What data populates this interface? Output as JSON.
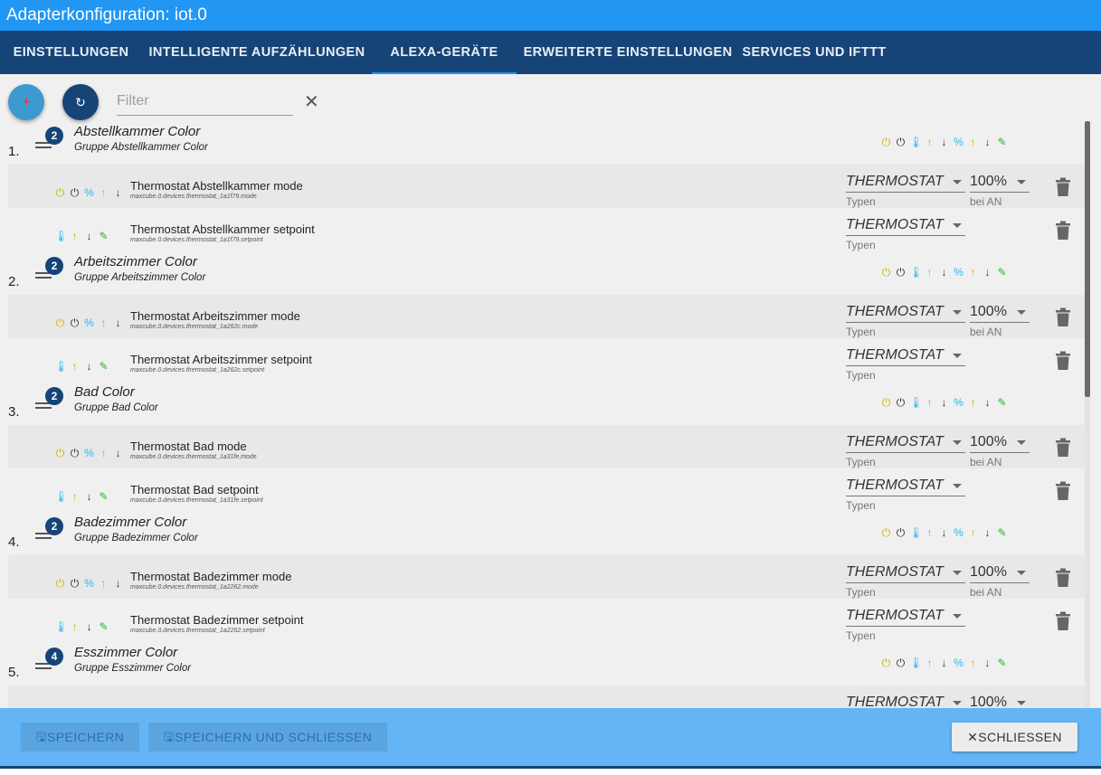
{
  "window": {
    "title": "Adapterkonfiguration: iot.0"
  },
  "tabs": [
    {
      "label": "EINSTELLUNGEN"
    },
    {
      "label": "INTELLIGENTE AUFZÄHLUNGEN"
    },
    {
      "label": "ALEXA-GERÄTE"
    },
    {
      "label": "ERWEITERTE EINSTELLUNGEN"
    },
    {
      "label": "SERVICES UND IFTTT"
    }
  ],
  "active_tab": "ALEXA-GERÄTE",
  "toolbar": {
    "add_icon": "plus-icon",
    "refresh_icon": "refresh-icon",
    "filter_placeholder": "Filter",
    "clear_icon": "close-icon"
  },
  "groups": [
    {
      "num": "1.",
      "count": "2",
      "title": "Abstellkammer Color",
      "subtitle": "Gruppe Abstellkammer Color",
      "devices": [
        {
          "name": "Thermostat Abstellkammer mode",
          "id": "maxcube.0.devices.thermostat_1a1f79.mode",
          "type": "THERMOSTAT",
          "type_label": "Typen",
          "percent": "100%",
          "percent_label": "bei AN"
        },
        {
          "name": "Thermostat Abstellkammer setpoint",
          "id": "maxcube.0.devices.thermostat_1a1f79.setpoint",
          "type": "THERMOSTAT",
          "type_label": "Typen"
        }
      ]
    },
    {
      "num": "2.",
      "count": "2",
      "title": "Arbeitszimmer Color",
      "subtitle": "Gruppe Arbeitszimmer Color",
      "devices": [
        {
          "name": "Thermostat Arbeitszimmer mode",
          "id": "maxcube.0.devices.thermostat_1a262c.mode",
          "type": "THERMOSTAT",
          "type_label": "Typen",
          "percent": "100%",
          "percent_label": "bei AN"
        },
        {
          "name": "Thermostat Arbeitszimmer setpoint",
          "id": "maxcube.0.devices.thermostat_1a262c.setpoint",
          "type": "THERMOSTAT",
          "type_label": "Typen"
        }
      ]
    },
    {
      "num": "3.",
      "count": "2",
      "title": "Bad Color",
      "subtitle": "Gruppe Bad Color",
      "devices": [
        {
          "name": "Thermostat Bad mode",
          "id": "maxcube.0.devices.thermostat_1a31fe.mode",
          "type": "THERMOSTAT",
          "type_label": "Typen",
          "percent": "100%",
          "percent_label": "bei AN"
        },
        {
          "name": "Thermostat Bad setpoint",
          "id": "maxcube.0.devices.thermostat_1a31fe.setpoint",
          "type": "THERMOSTAT",
          "type_label": "Typen"
        }
      ]
    },
    {
      "num": "4.",
      "count": "2",
      "title": "Badezimmer Color",
      "subtitle": "Gruppe Badezimmer Color",
      "devices": [
        {
          "name": "Thermostat Badezimmer mode",
          "id": "maxcube.0.devices.thermostat_1a2262.mode",
          "type": "THERMOSTAT",
          "type_label": "Typen",
          "percent": "100%",
          "percent_label": "bei AN"
        },
        {
          "name": "Thermostat Badezimmer setpoint",
          "id": "maxcube.0.devices.thermostat_1a2262.setpoint",
          "type": "THERMOSTAT",
          "type_label": "Typen"
        }
      ]
    },
    {
      "num": "5.",
      "count": "4",
      "title": "Esszimmer Color",
      "subtitle": "Gruppe Esszimmer Color",
      "devices": [
        {
          "name": "",
          "id": "",
          "type": "THERMOSTAT",
          "type_label": "",
          "percent": "100%",
          "percent_label": ""
        }
      ]
    }
  ],
  "icons": {
    "group": [
      "power-on-icon",
      "power-off-icon",
      "thermometer-icon",
      "arrow-up-icon",
      "arrow-down-icon",
      "percent-icon",
      "arrow-up-icon",
      "arrow-down-icon",
      "pipette-icon"
    ],
    "mode": [
      "power-on-icon",
      "power-off-icon",
      "percent-icon",
      "arrow-up-icon",
      "arrow-down-icon"
    ],
    "setpoint": [
      "thermometer-icon",
      "arrow-up-icon",
      "arrow-down-icon",
      "pipette-icon"
    ]
  },
  "colors": {
    "title_bar": "#2196f3",
    "tab_bar": "#164477",
    "footer": "#64b5f6",
    "accent": "#2196f3"
  },
  "footer": {
    "save_label": "SPEICHERN",
    "save_close_label": "SPEICHERN UND SCHLIESSEN",
    "close_label": "SCHLIESSEN",
    "save_icon": "floppy-disk-icon",
    "close_icon": "close-icon"
  }
}
